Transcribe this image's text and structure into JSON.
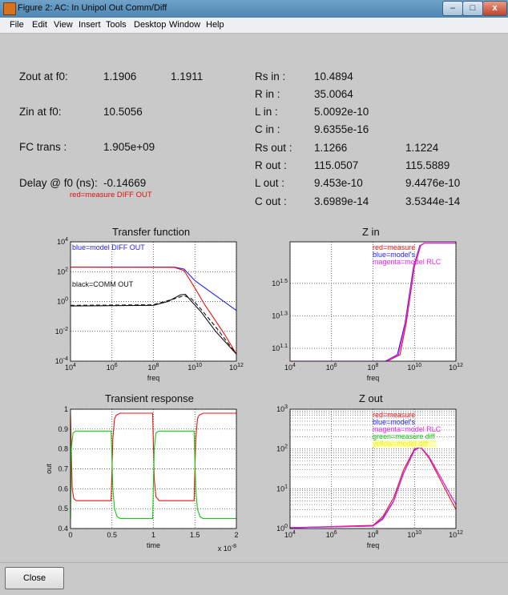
{
  "window": {
    "title": "Figure 2: AC: In Unipol Out Comm/Diff",
    "min_glyph": "–",
    "max_glyph": "□",
    "close_glyph": "x"
  },
  "menu": [
    "File",
    "Edit",
    "View",
    "Insert",
    "Tools",
    "Desktop",
    "Window",
    "Help"
  ],
  "left_info": [
    {
      "label": "Zout at f0:",
      "v1": "1.1906",
      "v2": "1.1911"
    },
    {
      "label": "Zin at f0:",
      "v1": "10.5056",
      "v2": ""
    },
    {
      "label": "FC trans :",
      "v1": "1.905e+09",
      "v2": ""
    },
    {
      "label": "Delay @ f0 (ns):",
      "v1": "-0.14669",
      "v2": ""
    }
  ],
  "left_note": "red=measure DIFF OUT",
  "right_info": [
    {
      "label": "Rs in :",
      "v1": "10.4894",
      "v2": ""
    },
    {
      "label": "R in :",
      "v1": "35.0064",
      "v2": ""
    },
    {
      "label": "L in :",
      "v1": "5.0092e-10",
      "v2": ""
    },
    {
      "label": "C in :",
      "v1": "9.6355e-16",
      "v2": ""
    },
    {
      "label": "Rs out :",
      "v1": "1.1266",
      "v2": "1.1224"
    },
    {
      "label": "R out :",
      "v1": "115.0507",
      "v2": "115.5889"
    },
    {
      "label": "L out :",
      "v1": "9.453e-10",
      "v2": "9.4476e-10"
    },
    {
      "label": "C out :",
      "v1": "3.6989e-14",
      "v2": "3.5344e-14"
    }
  ],
  "colors": {
    "red": "#ee1111",
    "blue": "#2222ee",
    "magenta": "#ee22ee",
    "green": "#11cc11",
    "black": "#111111",
    "yellow": "#eeee22"
  },
  "chart_data": [
    {
      "type": "line",
      "title": "Transfer function",
      "xlabel": "freq",
      "ylabel": "",
      "x_scale": "log",
      "y_scale": "log",
      "xlim": [
        10000,
        1000000000000
      ],
      "ylim": [
        0.0001,
        10000
      ],
      "x_ticks": [
        {
          "base": "10",
          "exp": "4"
        },
        {
          "base": "10",
          "exp": "6"
        },
        {
          "base": "10",
          "exp": "8"
        },
        {
          "base": "10",
          "exp": "10"
        },
        {
          "base": "10",
          "exp": "12"
        }
      ],
      "y_ticks": [
        {
          "base": "10",
          "exp": "-4"
        },
        {
          "base": "10",
          "exp": "-2"
        },
        {
          "base": "10",
          "exp": "0"
        },
        {
          "base": "10",
          "exp": "2"
        },
        {
          "base": "10",
          "exp": "4"
        }
      ],
      "grid": true,
      "annotations": [
        {
          "text": "blue=model DIFF OUT",
          "color": "#2222ee"
        },
        {
          "text": "black=COMM OUT",
          "color": "#111111"
        }
      ],
      "series": [
        {
          "color": "#2222ee",
          "style": "solid",
          "x": [
            10000,
            1000000000,
            3000000000,
            10000000000,
            100000000000,
            1000000000000
          ],
          "y": [
            200,
            200,
            150,
            25,
            2.5,
            0.25
          ]
        },
        {
          "color": "#ee1111",
          "style": "solid",
          "x": [
            10000,
            1000000000,
            3000000000,
            10000000000,
            30000000000,
            100000000000,
            300000000000,
            1000000000000
          ],
          "y": [
            200,
            195,
            120,
            8,
            0.6,
            0.05,
            0.005,
            0.0003
          ]
        },
        {
          "color": "#111111",
          "style": "solid",
          "x": [
            10000,
            100000000,
            500000000,
            2000000000,
            3500000000,
            7000000000,
            20000000000,
            100000000000,
            1000000000000
          ],
          "y": [
            0.5,
            0.55,
            1.0,
            2.8,
            3.0,
            1.0,
            0.2,
            0.01,
            0.0003
          ]
        },
        {
          "color": "#111111",
          "style": "dashed",
          "x": [
            10000,
            100000000,
            1000000000,
            3000000000,
            7000000000,
            20000000000,
            100000000000,
            1000000000000
          ],
          "y": [
            0.55,
            0.6,
            1.5,
            2.5,
            1.5,
            0.3,
            0.02,
            0.0003
          ]
        }
      ]
    },
    {
      "type": "line",
      "title": "Z in",
      "xlabel": "freq",
      "ylabel": "",
      "x_scale": "log",
      "y_scale": "log",
      "xlim": [
        10000,
        1000000000000
      ],
      "ylim": [
        10.5,
        57
      ],
      "x_ticks": [
        {
          "base": "10",
          "exp": "4"
        },
        {
          "base": "10",
          "exp": "6"
        },
        {
          "base": "10",
          "exp": "8"
        },
        {
          "base": "10",
          "exp": "10"
        },
        {
          "base": "10",
          "exp": "12"
        }
      ],
      "y_ticks": [
        {
          "base": "10",
          "exp": "1.1"
        },
        {
          "base": "10",
          "exp": "1.3"
        },
        {
          "base": "10",
          "exp": "1.5"
        }
      ],
      "grid": true,
      "annotations": [
        {
          "text": "red=measure",
          "color": "#ee1111"
        },
        {
          "text": "blue=model's",
          "color": "#2222ee"
        },
        {
          "text": "magenta=model RLC",
          "color": "#ee22ee"
        }
      ],
      "series": [
        {
          "color": "#ee1111",
          "style": "solid",
          "x": [
            10000,
            500000000,
            2000000000,
            4000000000,
            10000000000,
            20000000000,
            30000000000,
            1000000000000
          ],
          "y": [
            10.5,
            10.5,
            11.5,
            18,
            40,
            54,
            56,
            56
          ]
        },
        {
          "color": "#2222ee",
          "style": "solid",
          "x": [
            10000,
            400000000,
            1500000000,
            3500000000,
            9000000000,
            18000000000,
            30000000000,
            1000000000000
          ],
          "y": [
            10.5,
            10.5,
            11.5,
            18,
            40,
            54,
            56,
            56
          ]
        },
        {
          "color": "#ee22ee",
          "style": "solid",
          "x": [
            10000,
            450000000,
            1700000000,
            3700000000,
            9500000000,
            19000000000,
            30000000000,
            1000000000000
          ],
          "y": [
            10.5,
            10.5,
            11.5,
            18,
            40,
            54,
            56,
            56
          ]
        }
      ]
    },
    {
      "type": "line",
      "title": "Transient response",
      "xlabel": "time",
      "ylabel": "out",
      "x_multiplier": "x 10",
      "x_multiplier_exp": "-8",
      "xlim": [
        0,
        2
      ],
      "ylim": [
        0.4,
        1
      ],
      "x_ticks": [
        "0",
        "0.5",
        "1",
        "1.5",
        "2"
      ],
      "y_ticks": [
        "0.4",
        "0.5",
        "0.6",
        "0.7",
        "0.8",
        "0.9",
        "1"
      ],
      "grid": true,
      "series": [
        {
          "color": "#ee1111",
          "style": "solid",
          "x": [
            0,
            0.02,
            0.04,
            0.07,
            0.45,
            0.49,
            0.51,
            0.53,
            0.55,
            0.6,
            0.95,
            0.99,
            1.01,
            1.03,
            1.07,
            1.45,
            1.49,
            1.51,
            1.53,
            1.55,
            1.6,
            1.95,
            2
          ],
          "y": [
            0.97,
            0.6,
            0.55,
            0.54,
            0.54,
            0.54,
            0.85,
            0.95,
            0.97,
            0.98,
            0.98,
            0.98,
            0.65,
            0.56,
            0.54,
            0.54,
            0.54,
            0.85,
            0.95,
            0.97,
            0.98,
            0.98,
            0.98
          ]
        },
        {
          "color": "#11cc11",
          "style": "solid",
          "x": [
            0,
            0.01,
            0.03,
            0.06,
            0.49,
            0.51,
            0.53,
            0.56,
            0.6,
            0.99,
            1.01,
            1.03,
            1.06,
            1.49,
            1.51,
            1.53,
            1.56,
            1.6,
            2
          ],
          "y": [
            0.45,
            0.8,
            0.88,
            0.89,
            0.89,
            0.6,
            0.5,
            0.46,
            0.45,
            0.45,
            0.8,
            0.88,
            0.89,
            0.89,
            0.6,
            0.5,
            0.46,
            0.45,
            0.45
          ]
        }
      ]
    },
    {
      "type": "line",
      "title": "Z out",
      "xlabel": "freq",
      "ylabel": "",
      "x_scale": "log",
      "y_scale": "log",
      "xlim": [
        10000,
        1000000000000
      ],
      "ylim": [
        1,
        1000
      ],
      "x_ticks": [
        {
          "base": "10",
          "exp": "4"
        },
        {
          "base": "10",
          "exp": "6"
        },
        {
          "base": "10",
          "exp": "8"
        },
        {
          "base": "10",
          "exp": "10"
        },
        {
          "base": "10",
          "exp": "12"
        }
      ],
      "y_ticks": [
        {
          "base": "10",
          "exp": "0"
        },
        {
          "base": "10",
          "exp": "1"
        },
        {
          "base": "10",
          "exp": "2"
        },
        {
          "base": "10",
          "exp": "3"
        }
      ],
      "grid": true,
      "annotations": [
        {
          "text": "red=measure",
          "color": "#ee1111"
        },
        {
          "text": "blue=model's",
          "color": "#2222ee"
        },
        {
          "text": "magenta=model RLC",
          "color": "#ee22ee"
        },
        {
          "text": "green=measure diff",
          "color": "#11cc11"
        },
        {
          "text": "yellow=model diff",
          "color": "#eeee22"
        }
      ],
      "series": [
        {
          "color": "#ee1111",
          "style": "solid",
          "x": [
            10000,
            100000000,
            300000000,
            1000000000,
            3000000000,
            10000000000,
            20000000000,
            50000000000,
            200000000000,
            1000000000000
          ],
          "y": [
            1.05,
            1.2,
            2,
            6,
            30,
            100,
            110,
            60,
            15,
            3
          ]
        },
        {
          "color": "#2222ee",
          "style": "solid",
          "x": [
            10000,
            100000000,
            300000000,
            1000000000,
            3000000000,
            10000000000,
            20000000000,
            50000000000,
            200000000000,
            1000000000000
          ],
          "y": [
            1.05,
            1.15,
            1.8,
            5,
            25,
            95,
            112,
            65,
            18,
            4
          ]
        },
        {
          "color": "#ee22ee",
          "style": "solid",
          "x": [
            10000,
            100000000,
            300000000,
            1000000000,
            3000000000,
            10000000000,
            20000000000,
            50000000000,
            200000000000,
            1000000000000
          ],
          "y": [
            1.05,
            1.15,
            1.7,
            4.8,
            24,
            92,
            112,
            64,
            18,
            4
          ]
        }
      ]
    }
  ],
  "close_button": "Close"
}
